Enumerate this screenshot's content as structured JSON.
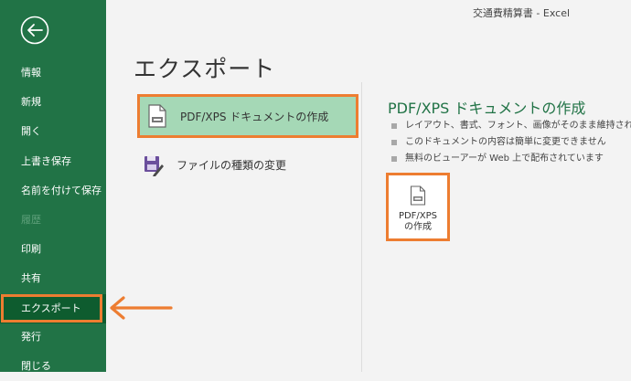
{
  "window": {
    "title": "交通費精算書 - Excel"
  },
  "sidebar": {
    "items": [
      {
        "label": "情報",
        "state": "normal"
      },
      {
        "label": "新規",
        "state": "normal"
      },
      {
        "label": "開く",
        "state": "normal"
      },
      {
        "label": "上書き保存",
        "state": "normal"
      },
      {
        "label": "名前を付けて保存",
        "state": "normal"
      },
      {
        "label": "履歴",
        "state": "disabled"
      },
      {
        "label": "印刷",
        "state": "normal"
      },
      {
        "label": "共有",
        "state": "normal"
      },
      {
        "label": "エクスポート",
        "state": "active"
      },
      {
        "label": "発行",
        "state": "normal"
      },
      {
        "label": "閉じる",
        "state": "normal"
      }
    ]
  },
  "main": {
    "title": "エクスポート",
    "options": [
      {
        "label": "PDF/XPS ドキュメントの作成",
        "selected": true,
        "icon": "pdf-document-icon"
      },
      {
        "label": "ファイルの種類の変更",
        "selected": false,
        "icon": "save-edit-icon"
      }
    ],
    "detail": {
      "title": "PDF/XPS ドキュメントの作成",
      "bullets": [
        "レイアウト、書式、フォント、画像がそのまま維持されます",
        "このドキュメントの内容は簡単に変更できません",
        "無料のビューアーが Web 上で配布されています"
      ],
      "button": {
        "line1": "PDF/XPS",
        "line2": "の作成",
        "icon": "pdf-document-icon"
      }
    }
  },
  "colors": {
    "sidebar_bg": "#217346",
    "sidebar_active": "#0e5c2f",
    "selected_option_bg": "#a5d8b6",
    "highlight": "#ed7d31",
    "accent_text": "#217346"
  }
}
